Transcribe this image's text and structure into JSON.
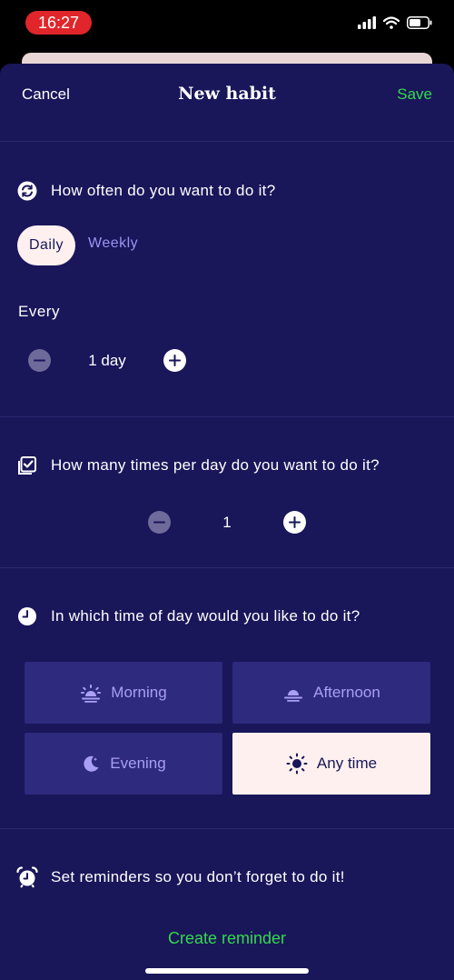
{
  "status_bar": {
    "time": "16:27"
  },
  "nav": {
    "cancel_label": "Cancel",
    "title": "New habit",
    "save_label": "Save"
  },
  "frequency": {
    "heading": "How often do you want to do it?",
    "options": [
      "Daily",
      "Weekly"
    ],
    "selected": "Daily",
    "every_label": "Every",
    "every_value": "1 day"
  },
  "times_per_day": {
    "heading": "How many times per day do you want to do it?",
    "value": "1"
  },
  "time_of_day": {
    "heading": "In which time of day would you like to do it?",
    "options": [
      {
        "label": "Morning",
        "icon": "sunrise-icon"
      },
      {
        "label": "Afternoon",
        "icon": "sunset-icon"
      },
      {
        "label": "Evening",
        "icon": "moon-icon"
      },
      {
        "label": "Any time",
        "icon": "sun-icon"
      }
    ],
    "selected": "Any time"
  },
  "reminders": {
    "heading": "Set reminders so you don’t forget to do it!",
    "create_label": "Create reminder"
  },
  "colors": {
    "background": "#19165a",
    "accent_green": "#35d84c",
    "chip_selected": "#fdf0ee",
    "option_bg": "#2e2a7d",
    "option_text": "#a99ff5"
  }
}
